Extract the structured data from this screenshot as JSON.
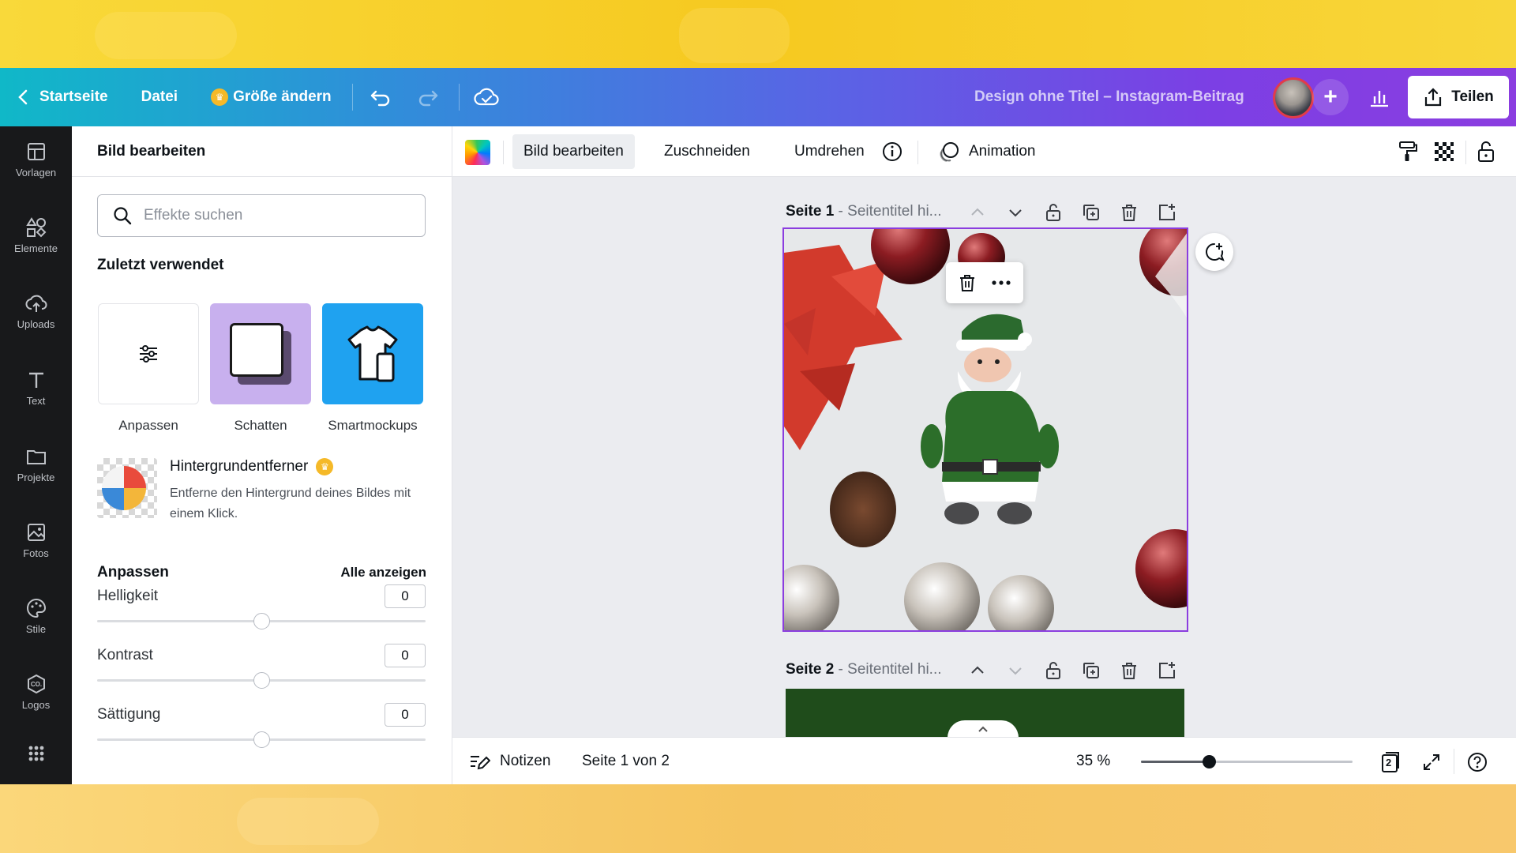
{
  "topbar": {
    "home_label": "Startseite",
    "file_label": "Datei",
    "resize_label": "Größe ändern",
    "design_title": "Design ohne Titel – Instagram-Beitrag",
    "share_label": "Teilen",
    "gradient_colors": [
      "#10b8c8",
      "#5a63e5",
      "#8b3de0"
    ]
  },
  "rail": {
    "items": [
      {
        "label": "Vorlagen",
        "icon": "templates-icon"
      },
      {
        "label": "Elemente",
        "icon": "elements-icon"
      },
      {
        "label": "Uploads",
        "icon": "upload-cloud-icon"
      },
      {
        "label": "Text",
        "icon": "text-icon"
      },
      {
        "label": "Projekte",
        "icon": "folder-icon"
      },
      {
        "label": "Fotos",
        "icon": "photo-icon"
      },
      {
        "label": "Stile",
        "icon": "palette-icon"
      },
      {
        "label": "Logos",
        "icon": "logo-icon"
      }
    ]
  },
  "panel": {
    "title": "Bild bearbeiten",
    "search_placeholder": "Effekte suchen",
    "recent_title": "Zuletzt verwendet",
    "recent": [
      {
        "label": "Anpassen"
      },
      {
        "label": "Schatten"
      },
      {
        "label": "Smartmockups"
      }
    ],
    "bg_remover": {
      "title": "Hintergrundentferner",
      "description": "Entferne den Hintergrund deines Bildes mit einem Klick."
    },
    "adjust_title": "Anpassen",
    "show_all": "Alle anzeigen",
    "adjustments": [
      {
        "label": "Helligkeit",
        "value": "0",
        "position": 0.5
      },
      {
        "label": "Kontrast",
        "value": "0",
        "position": 0.5
      },
      {
        "label": "Sättigung",
        "value": "0",
        "position": 0.5
      }
    ]
  },
  "toolbar": {
    "edit_image": "Bild bearbeiten",
    "crop": "Zuschneiden",
    "flip": "Umdrehen",
    "animation": "Animation"
  },
  "pages": [
    {
      "title": "Seite 1",
      "subtitle": "- Seitentitel hi..."
    },
    {
      "title": "Seite 2",
      "subtitle": "- Seitentitel hi..."
    }
  ],
  "bottombar": {
    "notes": "Notizen",
    "page_indicator": "Seite 1 von 2",
    "zoom": "35 %",
    "zoom_fraction": 0.32,
    "page_count": "2"
  }
}
